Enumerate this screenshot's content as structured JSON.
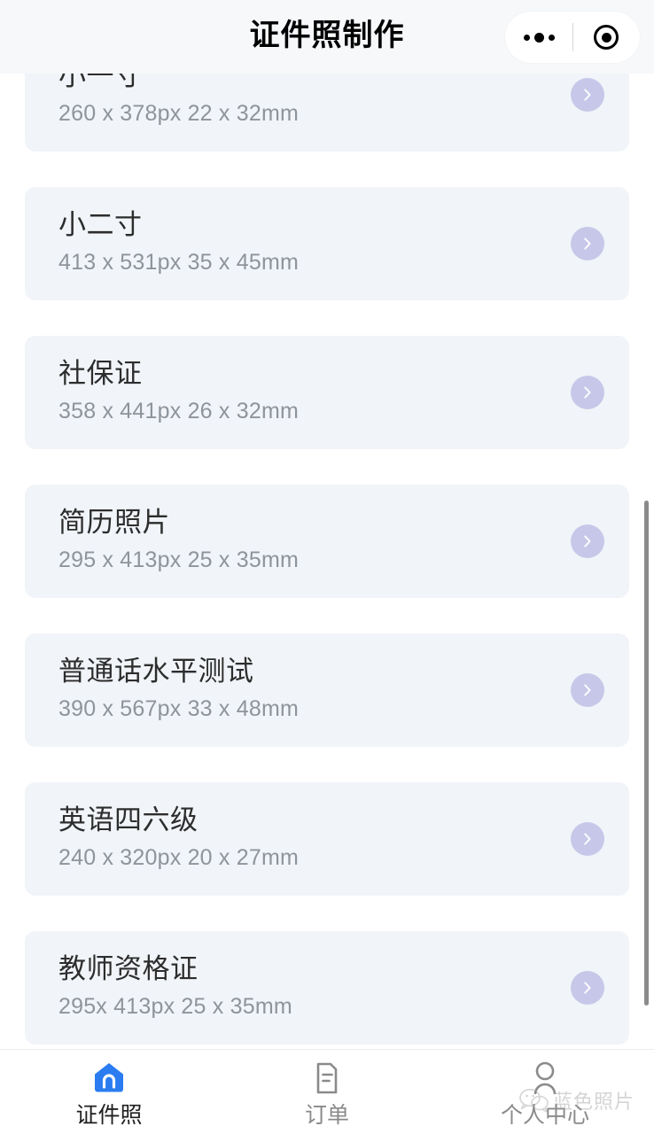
{
  "header": {
    "title": "证件照制作",
    "capsule": {
      "more_icon": "more-dots-icon",
      "target_icon": "target-circle-icon"
    }
  },
  "colors": {
    "page_bg": "#ffffff",
    "nav_bg": "#f6f8fa",
    "card_bg": "#f1f4f8",
    "chevron_bg": "#c7c7e9",
    "title_text": "#2d2d2d",
    "sub_text": "#8e949b",
    "tab_active": "#2b7cf0",
    "tab_inactive": "#8a8a8a",
    "scrollbar": "#8b8b8b"
  },
  "list": {
    "items": [
      {
        "name": "小一寸",
        "spec": "260 x 378px  22 x 32mm",
        "arrow_icon": "chevron-right-icon"
      },
      {
        "name": "小二寸",
        "spec": "413 x 531px  35 x 45mm",
        "arrow_icon": "chevron-right-icon"
      },
      {
        "name": "社保证",
        "spec": "358 x 441px  26 x 32mm",
        "arrow_icon": "chevron-right-icon"
      },
      {
        "name": "简历照片",
        "spec": "295 x 413px  25 x 35mm",
        "arrow_icon": "chevron-right-icon"
      },
      {
        "name": "普通话水平测试",
        "spec": "390 x 567px  33 x 48mm",
        "arrow_icon": "chevron-right-icon"
      },
      {
        "name": "英语四六级",
        "spec": "240 x 320px  20 x 27mm",
        "arrow_icon": "chevron-right-icon"
      },
      {
        "name": "教师资格证",
        "spec": "295x 413px  25 x 35mm",
        "arrow_icon": "chevron-right-icon"
      }
    ]
  },
  "tabbar": {
    "items": [
      {
        "label": "证件照",
        "icon": "home-icon",
        "active": true
      },
      {
        "label": "订单",
        "icon": "document-icon",
        "active": false
      },
      {
        "label": "个人中心",
        "icon": "person-icon",
        "active": false
      }
    ]
  },
  "watermark": {
    "text": "蓝色照片",
    "icon": "wechat-icon"
  }
}
